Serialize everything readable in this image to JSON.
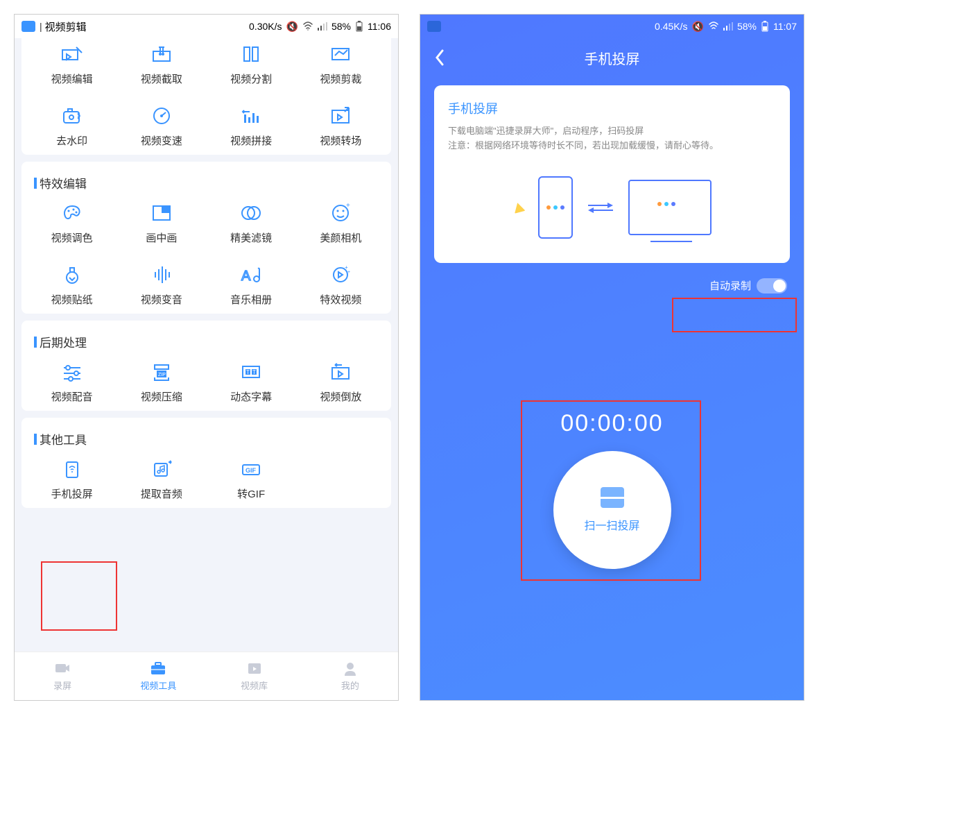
{
  "left": {
    "status": {
      "title": "视频剪辑",
      "speed": "0.30K/s",
      "battery": "58%",
      "time": "11:06"
    },
    "section1": {
      "items": [
        {
          "label": "视频编辑"
        },
        {
          "label": "视频截取"
        },
        {
          "label": "视频分割"
        },
        {
          "label": "视频剪裁"
        },
        {
          "label": "去水印"
        },
        {
          "label": "视频变速"
        },
        {
          "label": "视频拼接"
        },
        {
          "label": "视频转场"
        }
      ]
    },
    "section2": {
      "title": "特效编辑",
      "items": [
        {
          "label": "视频调色"
        },
        {
          "label": "画中画"
        },
        {
          "label": "精美滤镜"
        },
        {
          "label": "美颜相机"
        },
        {
          "label": "视频贴纸"
        },
        {
          "label": "视频变音"
        },
        {
          "label": "音乐相册"
        },
        {
          "label": "特效视频"
        }
      ]
    },
    "section3": {
      "title": "后期处理",
      "items": [
        {
          "label": "视频配音"
        },
        {
          "label": "视频压缩"
        },
        {
          "label": "动态字幕"
        },
        {
          "label": "视频倒放"
        }
      ]
    },
    "section4": {
      "title": "其他工具",
      "items": [
        {
          "label": "手机投屏"
        },
        {
          "label": "提取音频"
        },
        {
          "label": "转GIF"
        }
      ]
    },
    "nav": [
      {
        "label": "录屏"
      },
      {
        "label": "视频工具"
      },
      {
        "label": "视频库"
      },
      {
        "label": "我的"
      }
    ]
  },
  "right": {
    "status": {
      "speed": "0.45K/s",
      "battery": "58%",
      "time": "11:07"
    },
    "header": "手机投屏",
    "card": {
      "title": "手机投屏",
      "line1": "下载电脑端\"迅捷录屏大师\"，启动程序，扫码投屏",
      "line2": "注意：根据网络环境等待时长不同，若出现加载缓慢，请耐心等待。"
    },
    "auto_record": "自动录制",
    "timer": "00:00:00",
    "scan_label": "扫一扫投屏"
  }
}
